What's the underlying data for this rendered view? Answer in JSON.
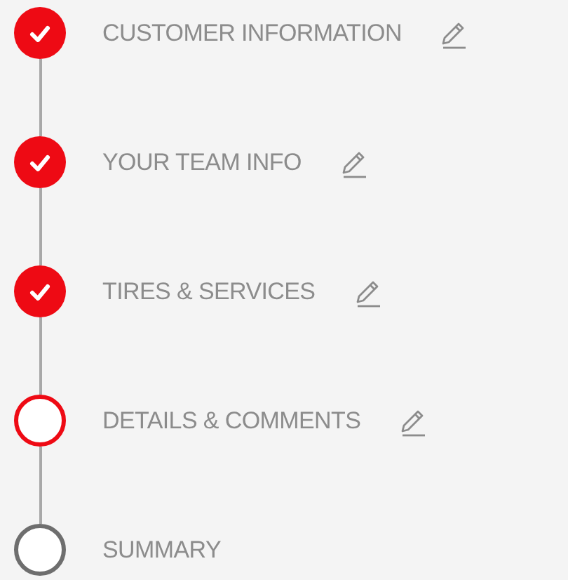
{
  "steps": [
    {
      "label": "CUSTOMER INFORMATION",
      "kind": "done",
      "editable": true
    },
    {
      "label": "YOUR TEAM INFO",
      "kind": "done",
      "editable": true
    },
    {
      "label": "TIRES & SERVICES",
      "kind": "done",
      "editable": true
    },
    {
      "label": "DETAILS & COMMENTS",
      "kind": "current",
      "editable": true
    },
    {
      "label": "SUMMARY",
      "kind": "pending",
      "editable": false
    }
  ]
}
